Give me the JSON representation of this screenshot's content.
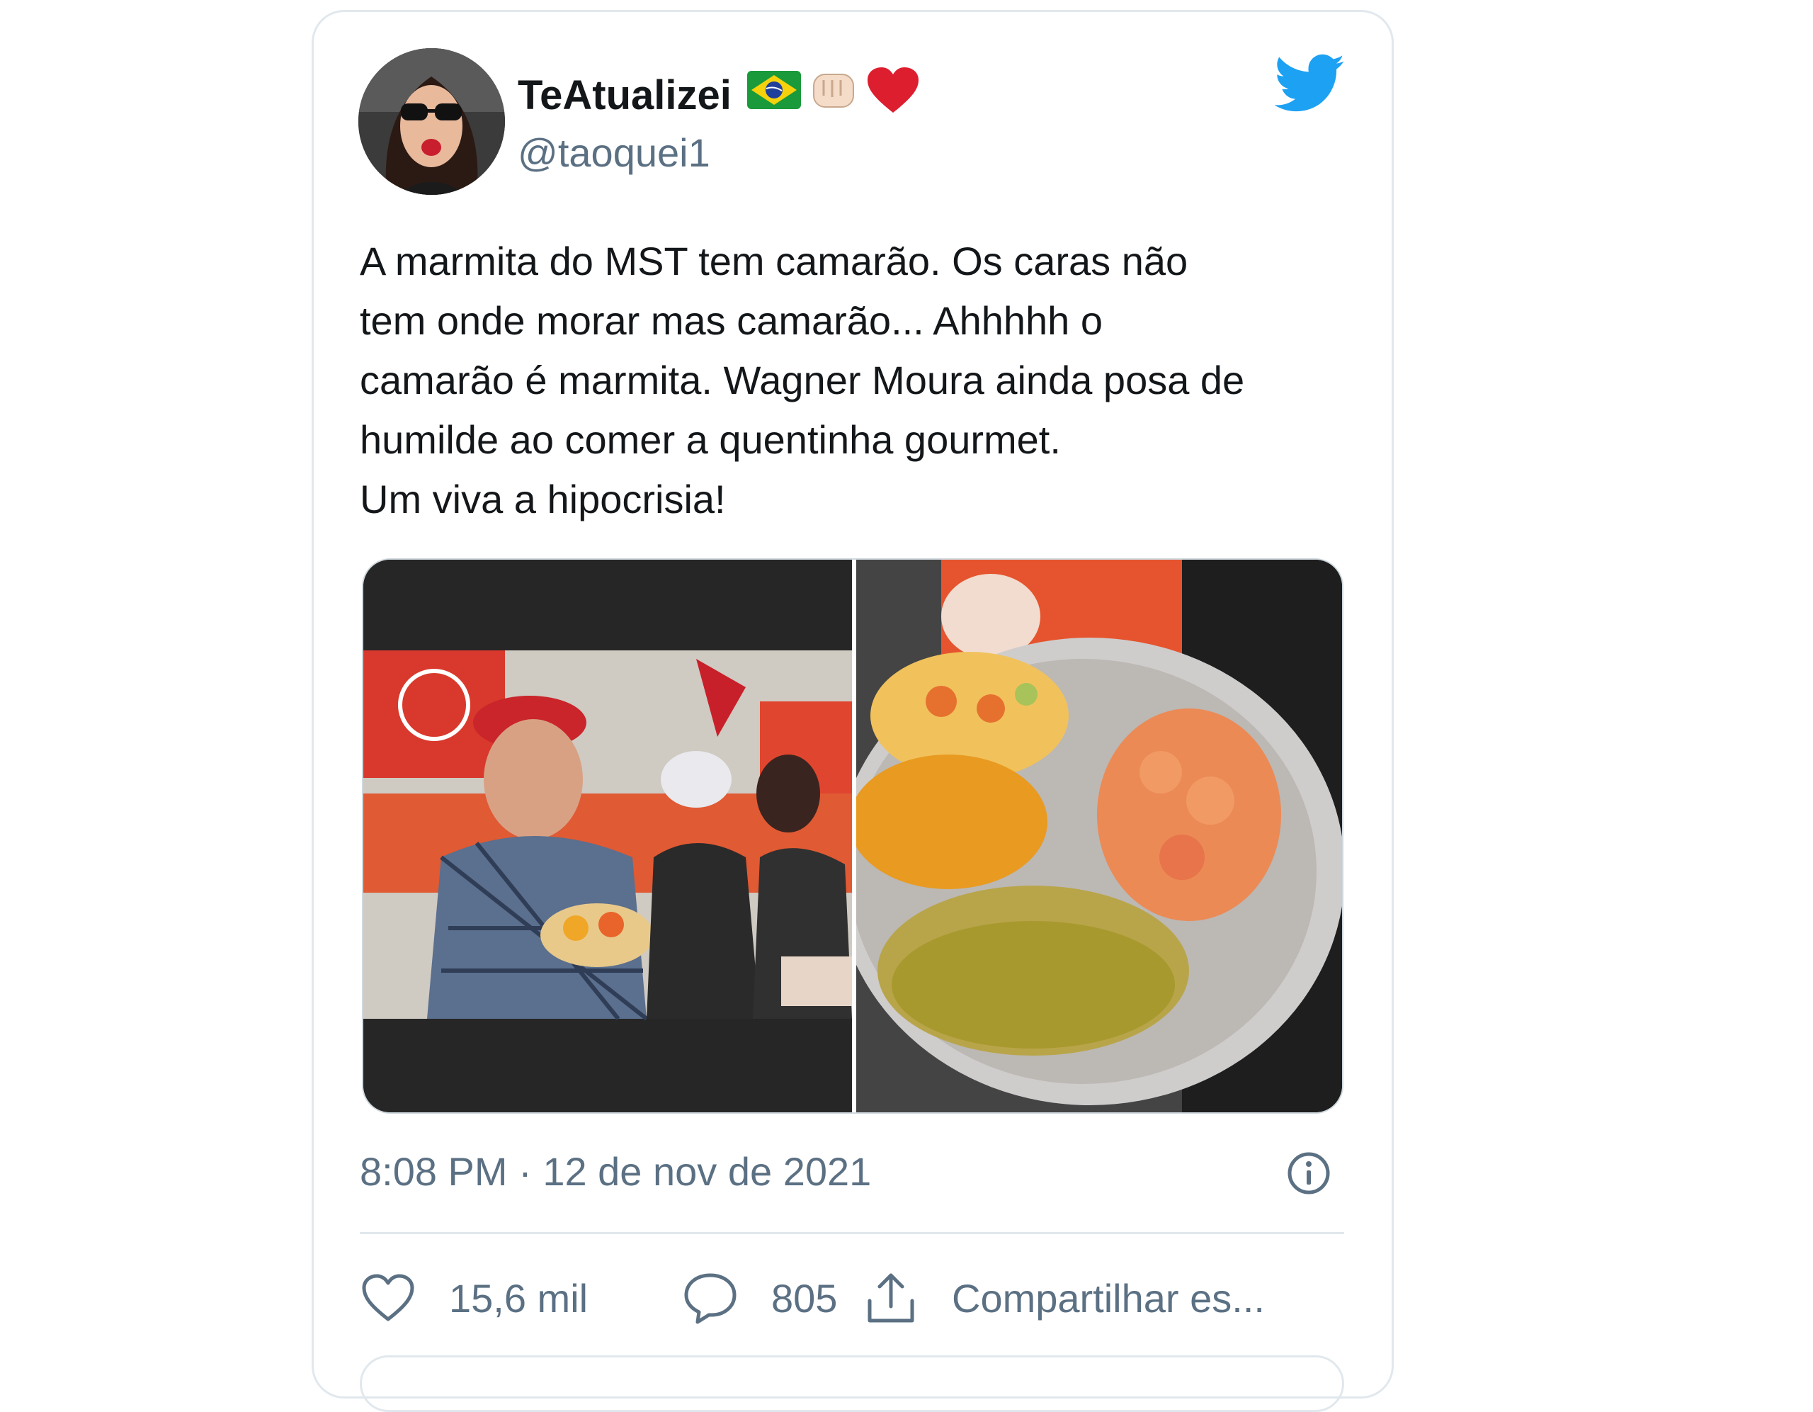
{
  "tweet": {
    "display_name": "TeAtualizei",
    "name_emojis": [
      "brazil-flag",
      "raised-fist-light",
      "red-heart"
    ],
    "handle": "@taoquei1",
    "text_lines": [
      "A marmita do MST tem camarão. Os caras não",
      "tem onde morar mas camarão... Ahhhhh o",
      "camarão é marmita. Wagner Moura ainda posa de",
      "humilde ao comer a quentinha gourmet.",
      "Um viva a hipocrisia!"
    ],
    "timestamp": "8:08 PM · 12 de nov de 2021",
    "likes": "15,6 mil",
    "replies": "805",
    "share_label": "Compartilhar es..."
  },
  "colors": {
    "text": "#14171a",
    "secondary": "#5b7083",
    "twitter_blue": "#1da1f2",
    "border": "#e1e8ed"
  }
}
